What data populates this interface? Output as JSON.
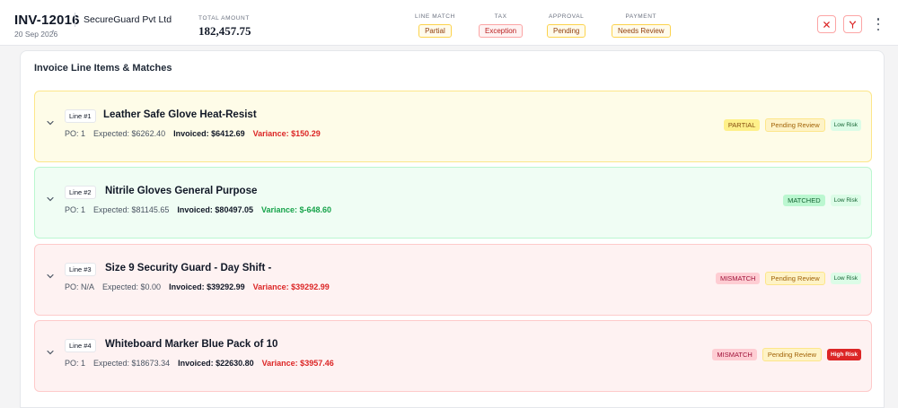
{
  "header": {
    "invoice_id": "INV-12016",
    "vendor": "SecureGuard Pvt Ltd",
    "date": "20 Sep 2026",
    "date_caret": "•",
    "total_label": "TOTAL AMOUNT",
    "total_value": "182,457.75",
    "statuses": [
      {
        "label": "LINE MATCH",
        "value": "Partial",
        "tone": "warn"
      },
      {
        "label": "TAX",
        "value": "Exception",
        "tone": "err"
      },
      {
        "label": "APPROVAL",
        "value": "Pending",
        "tone": "warn"
      },
      {
        "label": "PAYMENT",
        "value": "Needs Review",
        "tone": "warn"
      }
    ],
    "actions": [
      "close-icon",
      "merge-icon",
      "more-vertical-icon"
    ]
  },
  "panel": {
    "title": "Invoice Line Items & Matches",
    "lines": [
      {
        "num": "Line #1",
        "title": "Leather Safe Glove Heat-Resist",
        "po": "PO: 1",
        "expected": "Expected: $6262.40",
        "invoiced": "Invoiced: $6412.69",
        "variance": "Variance: $150.29",
        "match": "PARTIAL",
        "review": "Pending Review",
        "risk": "Low Risk"
      },
      {
        "num": "Line #2",
        "title": "Nitrile Gloves General Purpose",
        "po": "PO: 1",
        "expected": "Expected: $81145.65",
        "invoiced": "Invoiced: $80497.05",
        "variance": "Variance: $-648.60",
        "match": "MATCHED",
        "review": "",
        "risk": "Low Risk"
      },
      {
        "num": "Line #3",
        "title": "Size 9 Security Guard - Day Shift -",
        "po": "PO: N/A",
        "expected": "Expected: $0.00",
        "invoiced": "Invoiced: $39292.99",
        "variance": "Variance: $39292.99",
        "match": "MISMATCH",
        "review": "Pending Review",
        "risk": "Low Risk"
      },
      {
        "num": "Line #4",
        "title": "Whiteboard Marker Blue Pack of 10",
        "po": "PO: 1",
        "expected": "Expected: $18673.34",
        "invoiced": "Invoiced: $22630.80",
        "variance": "Variance: $3957.46",
        "match": "MISMATCH",
        "review": "Pending Review",
        "risk": "High Risk"
      }
    ]
  }
}
